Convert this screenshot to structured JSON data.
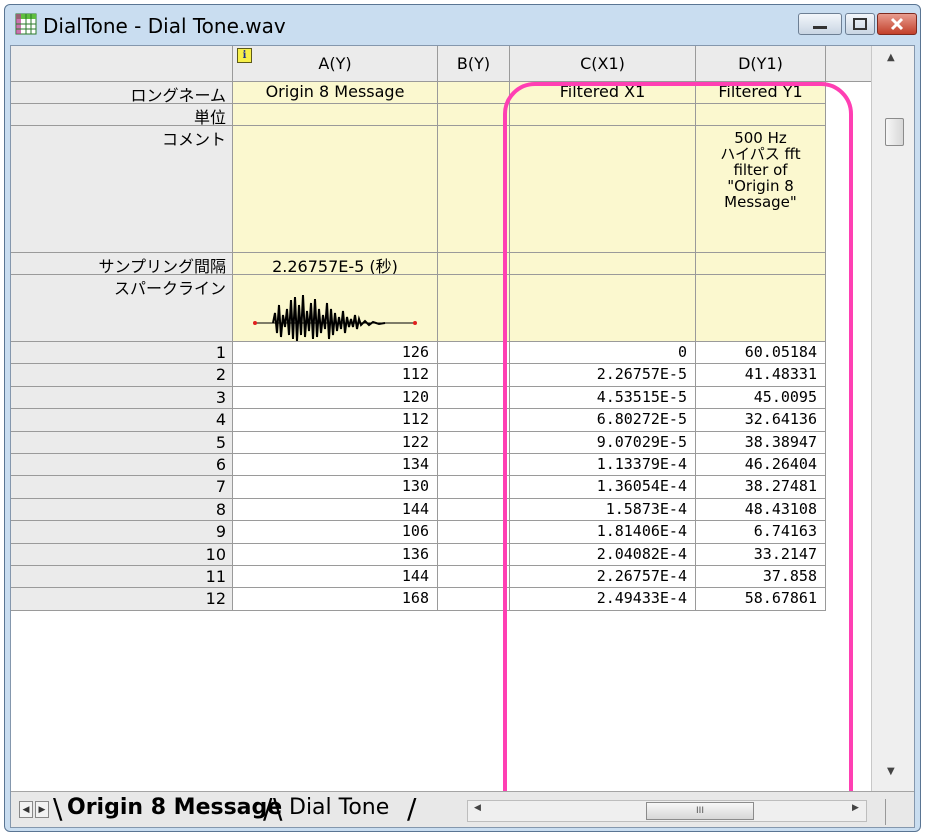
{
  "window": {
    "title": "DialTone - Dial Tone.wav"
  },
  "columns": [
    {
      "label": "A(Y)",
      "long_name": "Origin 8 Message",
      "units": "",
      "comment": "",
      "sampling_interval": "2.26757E-5 (秒)",
      "has_sparkline": true
    },
    {
      "label": "B(Y)",
      "long_name": "",
      "units": "",
      "comment": "",
      "sampling_interval": "",
      "has_sparkline": false
    },
    {
      "label": "C(X1)",
      "long_name": "Filtered X1",
      "units": "",
      "comment": "",
      "sampling_interval": "",
      "has_sparkline": false
    },
    {
      "label": "D(Y1)",
      "long_name": "Filtered Y1",
      "units": "",
      "comment": "500 Hz\nハイパス fft\nfilter of\n\"Origin 8\nMessage\"",
      "sampling_interval": "",
      "has_sparkline": false
    }
  ],
  "meta_rows": {
    "long_name": "ロングネーム",
    "units": "単位",
    "comment": "コメント",
    "sampling_interval": "サンプリング間隔",
    "sparkline": "スパークライン"
  },
  "rows": [
    {
      "n": "1",
      "a": "126",
      "b": "",
      "c": "0",
      "d": "60.05184"
    },
    {
      "n": "2",
      "a": "112",
      "b": "",
      "c": "2.26757E-5",
      "d": "41.48331"
    },
    {
      "n": "3",
      "a": "120",
      "b": "",
      "c": "4.53515E-5",
      "d": "45.0095"
    },
    {
      "n": "4",
      "a": "112",
      "b": "",
      "c": "6.80272E-5",
      "d": "32.64136"
    },
    {
      "n": "5",
      "a": "122",
      "b": "",
      "c": "9.07029E-5",
      "d": "38.38947"
    },
    {
      "n": "6",
      "a": "134",
      "b": "",
      "c": "1.13379E-4",
      "d": "46.26404"
    },
    {
      "n": "7",
      "a": "130",
      "b": "",
      "c": "1.36054E-4",
      "d": "38.27481"
    },
    {
      "n": "8",
      "a": "144",
      "b": "",
      "c": "1.5873E-4",
      "d": "48.43108"
    },
    {
      "n": "9",
      "a": "106",
      "b": "",
      "c": "1.81406E-4",
      "d": "6.74163"
    },
    {
      "n": "10",
      "a": "136",
      "b": "",
      "c": "2.04082E-4",
      "d": "33.2147"
    },
    {
      "n": "11",
      "a": "144",
      "b": "",
      "c": "2.26757E-4",
      "d": "37.858"
    },
    {
      "n": "12",
      "a": "168",
      "b": "",
      "c": "2.49433E-4",
      "d": "58.67861"
    }
  ],
  "sheet_tabs": [
    {
      "label": "Origin 8 Message",
      "active": true
    },
    {
      "label": "Dial Tone",
      "active": false
    }
  ],
  "colors": {
    "highlight": "#ff3fb3",
    "meta_background": "#fbf8cf",
    "header_background": "#ebebeb"
  }
}
